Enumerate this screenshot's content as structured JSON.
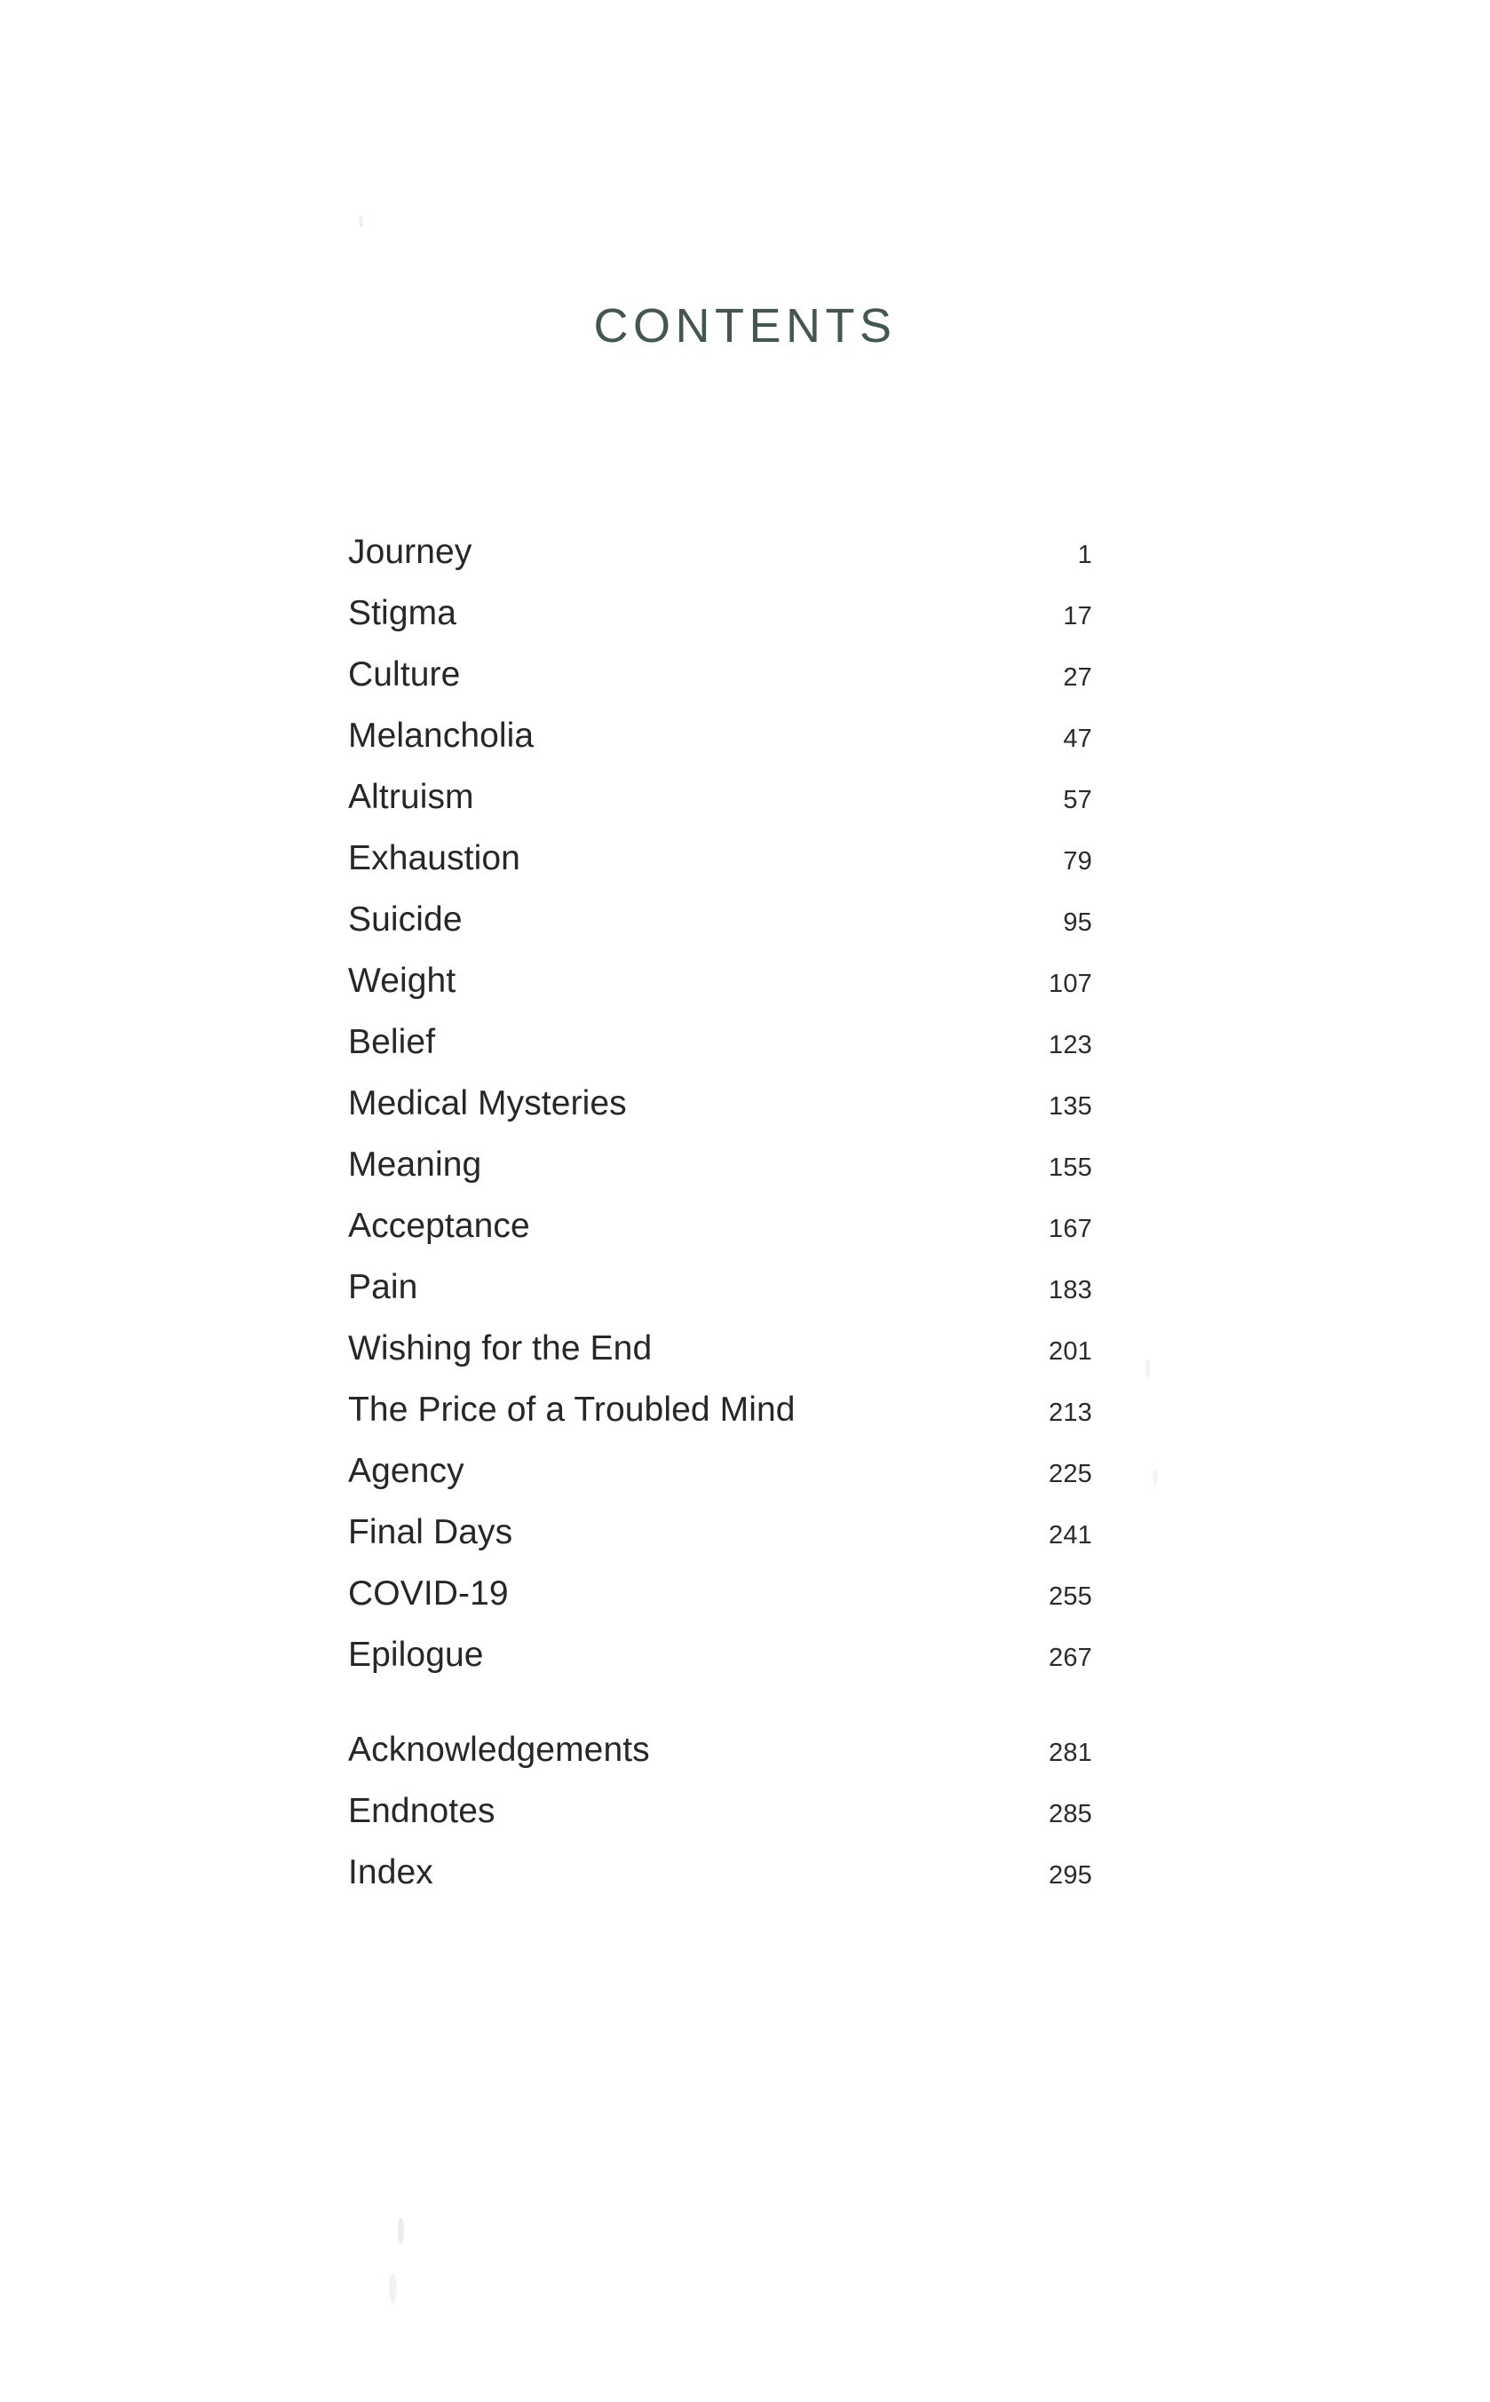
{
  "page": {
    "heading": "CONTENTS",
    "heading_color": "#44564F",
    "text_color": "#272727",
    "background_color": "#FFFFFF"
  },
  "contents": {
    "groups": [
      {
        "name": "chapters",
        "entries": [
          {
            "title": "Journey",
            "page": "1"
          },
          {
            "title": "Stigma",
            "page": "17"
          },
          {
            "title": "Culture",
            "page": "27"
          },
          {
            "title": "Melancholia",
            "page": "47"
          },
          {
            "title": "Altruism",
            "page": "57"
          },
          {
            "title": "Exhaustion",
            "page": "79"
          },
          {
            "title": "Suicide",
            "page": "95"
          },
          {
            "title": "Weight",
            "page": "107"
          },
          {
            "title": "Belief",
            "page": "123"
          },
          {
            "title": "Medical Mysteries",
            "page": "135"
          },
          {
            "title": "Meaning",
            "page": "155"
          },
          {
            "title": "Acceptance",
            "page": "167"
          },
          {
            "title": "Pain",
            "page": "183"
          },
          {
            "title": "Wishing for the End",
            "page": "201"
          },
          {
            "title": "The Price of a Troubled Mind",
            "page": "213"
          },
          {
            "title": "Agency",
            "page": "225"
          },
          {
            "title": "Final Days",
            "page": "241"
          },
          {
            "title": "COVID-19",
            "page": "255"
          },
          {
            "title": "Epilogue",
            "page": "267"
          }
        ]
      },
      {
        "name": "back-matter",
        "entries": [
          {
            "title": "Acknowledgements",
            "page": "281"
          },
          {
            "title": "Endnotes",
            "page": "285"
          },
          {
            "title": "Index",
            "page": "295"
          }
        ]
      }
    ]
  }
}
